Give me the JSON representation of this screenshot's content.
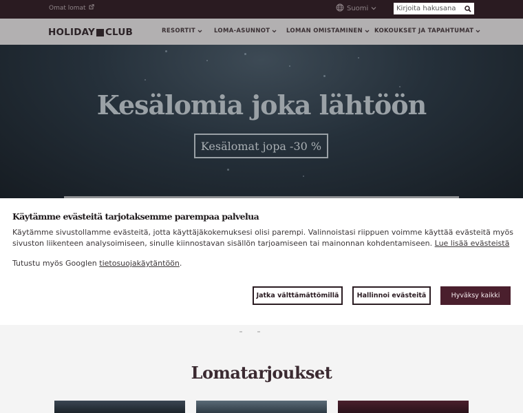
{
  "topbar": {
    "omat_lomat": "Omat lomat",
    "language": "Suomi",
    "search_placeholder": "Kirjoita hakusana"
  },
  "nav": {
    "logo_left": "HOLIDAY",
    "logo_right": "CLUB",
    "items": [
      {
        "label": "RESORTIT"
      },
      {
        "label": "LOMA-ASUNNOT"
      },
      {
        "label": "LOMAN OMISTAMINEN"
      },
      {
        "label": "KOKOUKSET JA TAPAHTUMAT"
      }
    ]
  },
  "hero": {
    "title": "Kesälomia joka lähtöön",
    "cta": "Kesälomat jopa -30 %"
  },
  "cookie": {
    "title": "Käytämme evästeitä tarjotaksemme parempaa palvelua",
    "text": "Käytämme sivustollamme evästeitä, jotta käyttäjäkokemuksesi olisi parempi. Valinnoistasi riippuen voimme käyttää evästeitä myös sivuston liikenteen analysoimiseen, sinulle kiinnostavan sisällön tarjoamiseen tai mainonnan kohdentamiseen.",
    "learn_more": "Lue lisää evästeistä",
    "google_prefix": "Tutustu myös Googlen",
    "google_link": "tietosuojakäytäntöön",
    "google_suffix": ".",
    "btn_necessary": "Jatka välttämättömillä",
    "btn_manage": "Hallinnoi evästeitä",
    "btn_accept": "Hyväksy kaikki"
  },
  "offers": {
    "title": "Lomatarjoukset"
  },
  "colors": {
    "topbar": "#2a1b21",
    "accent": "#4a1f2d",
    "nav": "#b2b0b1"
  }
}
